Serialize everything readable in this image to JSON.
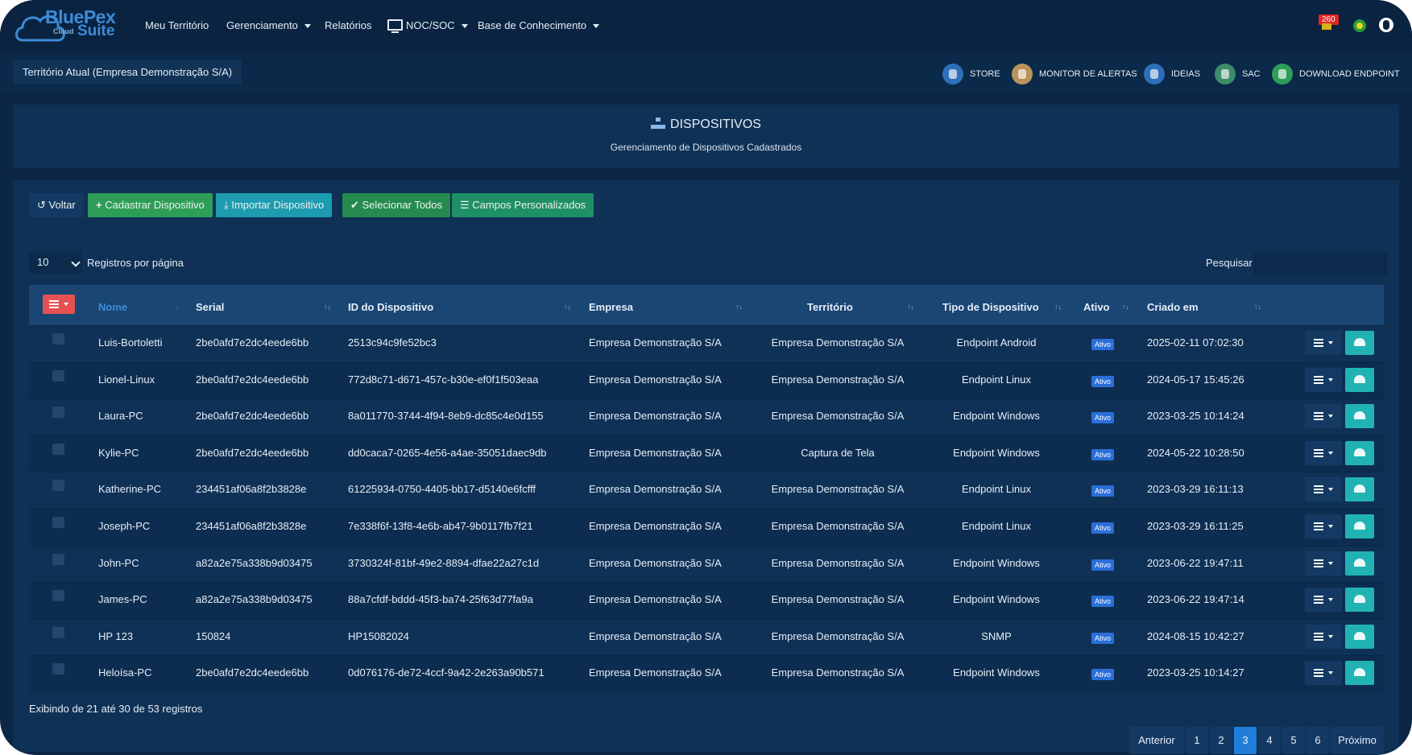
{
  "brand": {
    "name": "BluePex",
    "sub": "Cloud",
    "suite": "Suite",
    "color": "#3d8bd8"
  },
  "nav": {
    "items": [
      {
        "label": "Meu Território",
        "dropdown": false
      },
      {
        "label": "Gerenciamento",
        "dropdown": true
      },
      {
        "label": "Relatórios",
        "dropdown": false
      },
      {
        "label": "NOC/SOC",
        "dropdown": true,
        "icon": "monitor-icon"
      },
      {
        "label": "Base de Conhecimento",
        "dropdown": true
      }
    ],
    "notifications": "260"
  },
  "subbar": {
    "territory": "Território Atual (Empresa Demonstração S/A)",
    "quick_links": [
      {
        "label": "STORE",
        "icon": "store-icon",
        "color": "#2d6fb8"
      },
      {
        "label": "MONITOR DE ALERTAS",
        "icon": "alert-monitor-icon",
        "color": "#b8935a"
      },
      {
        "label": "IDEIAS",
        "icon": "lightbulb-icon",
        "color": "#2d6fb8"
      },
      {
        "label": "SAC",
        "icon": "headset-icon",
        "color": "#3c8c6a"
      },
      {
        "label": "DOWNLOAD ENDPOINT",
        "icon": "download-icon",
        "color": "#2e9e57"
      }
    ]
  },
  "header": {
    "title": "DISPOSITIVOS",
    "subtitle": "Gerenciamento de Dispositivos Cadastrados"
  },
  "toolbar": {
    "back": "Voltar",
    "add": "Cadastrar Dispositivo",
    "import": "Importar Dispositivo",
    "select_all": "Selecionar Todos",
    "custom_fields": "Campos Personalizados"
  },
  "table_controls": {
    "per_page_value": "10",
    "per_page_label": "Registros por página",
    "search_label": "Pesquisar",
    "search_value": ""
  },
  "table": {
    "columns": [
      "Nome",
      "Serial",
      "ID do Dispositivo",
      "Empresa",
      "Território",
      "Tipo de Dispositivo",
      "Ativo",
      "Criado em"
    ],
    "rows": [
      {
        "nome": "Luis-Bortoletti",
        "serial": "2be0afd7e2dc4eede6bb",
        "id": "2513c94c9fe52bc3",
        "empresa": "Empresa Demonstração S/A",
        "territorio": "Empresa Demonstração S/A",
        "tipo": "Endpoint Android",
        "ativo": "Ativo",
        "criado": "2025-02-11 07:02:30"
      },
      {
        "nome": "Lionel-Linux",
        "serial": "2be0afd7e2dc4eede6bb",
        "id": "772d8c71-d671-457c-b30e-ef0f1f503eaa",
        "empresa": "Empresa Demonstração S/A",
        "territorio": "Empresa Demonstração S/A",
        "tipo": "Endpoint Linux",
        "ativo": "Ativo",
        "criado": "2024-05-17 15:45:26"
      },
      {
        "nome": "Laura-PC",
        "serial": "2be0afd7e2dc4eede6bb",
        "id": "8a011770-3744-4f94-8eb9-dc85c4e0d155",
        "empresa": "Empresa Demonstração S/A",
        "territorio": "Empresa Demonstração S/A",
        "tipo": "Endpoint Windows",
        "ativo": "Ativo",
        "criado": "2023-03-25 10:14:24"
      },
      {
        "nome": "Kylie-PC",
        "serial": "2be0afd7e2dc4eede6bb",
        "id": "dd0caca7-0265-4e56-a4ae-35051daec9db",
        "empresa": "Empresa Demonstração S/A",
        "territorio": "Captura de Tela",
        "tipo": "Endpoint Windows",
        "ativo": "Ativo",
        "criado": "2024-05-22 10:28:50"
      },
      {
        "nome": "Katherine-PC",
        "serial": "234451af06a8f2b3828e",
        "id": "61225934-0750-4405-bb17-d5140e6fcfff",
        "empresa": "Empresa Demonstração S/A",
        "territorio": "Empresa Demonstração S/A",
        "tipo": "Endpoint Linux",
        "ativo": "Ativo",
        "criado": "2023-03-29 16:11:13"
      },
      {
        "nome": "Joseph-PC",
        "serial": "234451af06a8f2b3828e",
        "id": "7e338f6f-13f8-4e6b-ab47-9b0117fb7f21",
        "empresa": "Empresa Demonstração S/A",
        "territorio": "Empresa Demonstração S/A",
        "tipo": "Endpoint Linux",
        "ativo": "Ativo",
        "criado": "2023-03-29 16:11:25"
      },
      {
        "nome": "John-PC",
        "serial": "a82a2e75a338b9d03475",
        "id": "3730324f-81bf-49e2-8894-dfae22a27c1d",
        "empresa": "Empresa Demonstração S/A",
        "territorio": "Empresa Demonstração S/A",
        "tipo": "Endpoint Windows",
        "ativo": "Ativo",
        "criado": "2023-06-22 19:47:11"
      },
      {
        "nome": "James-PC",
        "serial": "a82a2e75a338b9d03475",
        "id": "88a7cfdf-bddd-45f3-ba74-25f63d77fa9a",
        "empresa": "Empresa Demonstração S/A",
        "territorio": "Empresa Demonstração S/A",
        "tipo": "Endpoint Windows",
        "ativo": "Ativo",
        "criado": "2023-06-22 19:47:14"
      },
      {
        "nome": "HP 123",
        "serial": "150824",
        "id": "HP15082024",
        "empresa": "Empresa Demonstração S/A",
        "territorio": "Empresa Demonstração S/A",
        "tipo": "SNMP",
        "ativo": "Ativo",
        "criado": "2024-08-15 10:42:27"
      },
      {
        "nome": "Heloísa-PC",
        "serial": "2be0afd7e2dc4eede6bb",
        "id": "0d076176-de72-4ccf-9a42-2e263a90b571",
        "empresa": "Empresa Demonstração S/A",
        "territorio": "Empresa Demonstração S/A",
        "tipo": "Endpoint Windows",
        "ativo": "Ativo",
        "criado": "2023-03-25 10:14:27"
      }
    ]
  },
  "footer": {
    "summary": "Exibindo de 21 até 30 de 53 registros",
    "pagination": [
      "Anterior",
      "1",
      "2",
      "3",
      "4",
      "5",
      "6",
      "Próximo"
    ],
    "current_page": "3"
  },
  "colors": {
    "background": "#0c2745",
    "panel": "#0f3156",
    "header_row": "#1a4674",
    "accent_blue": "#1f7fd8",
    "accent_red": "#e65252",
    "accent_teal": "#21b3b3",
    "status_active": "#2a6fd9"
  }
}
